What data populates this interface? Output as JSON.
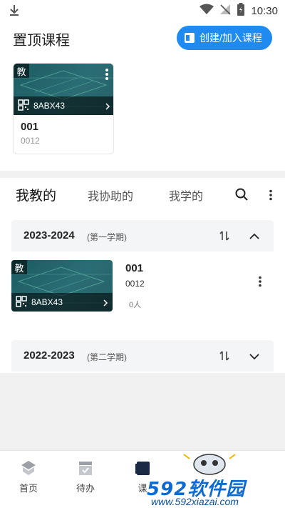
{
  "status_bar": {
    "time": "10:30"
  },
  "header": {
    "title": "置顶课程",
    "create_button_label": "创建/加入课程"
  },
  "pinned_course": {
    "badge": "教",
    "code": "8ABX43",
    "name": "001",
    "course_number": "0012"
  },
  "tabs": [
    {
      "label": "我教的",
      "active": true
    },
    {
      "label": "我协助的",
      "active": false
    },
    {
      "label": "我学的",
      "active": false
    }
  ],
  "terms": [
    {
      "year": "2023-2024",
      "semester": "(第一学期)",
      "expanded": true,
      "courses": [
        {
          "badge": "教",
          "code": "8ABX43",
          "name": "001",
          "course_number": "0012",
          "members": "0人"
        }
      ]
    },
    {
      "year": "2022-2023",
      "semester": "(第二学期)",
      "expanded": false,
      "courses": []
    }
  ],
  "bottom_nav": [
    {
      "label": "首页",
      "icon": "home-icon"
    },
    {
      "label": "待办",
      "icon": "todo-icon"
    },
    {
      "label": "课",
      "icon": "course-icon"
    }
  ],
  "watermark": {
    "logo": "592软件园",
    "url": "www.592xiazai.com"
  },
  "colors": {
    "accent": "#1f8bf0",
    "card_thumb": "#1b5b62",
    "section_bg": "#f4f5f7"
  }
}
